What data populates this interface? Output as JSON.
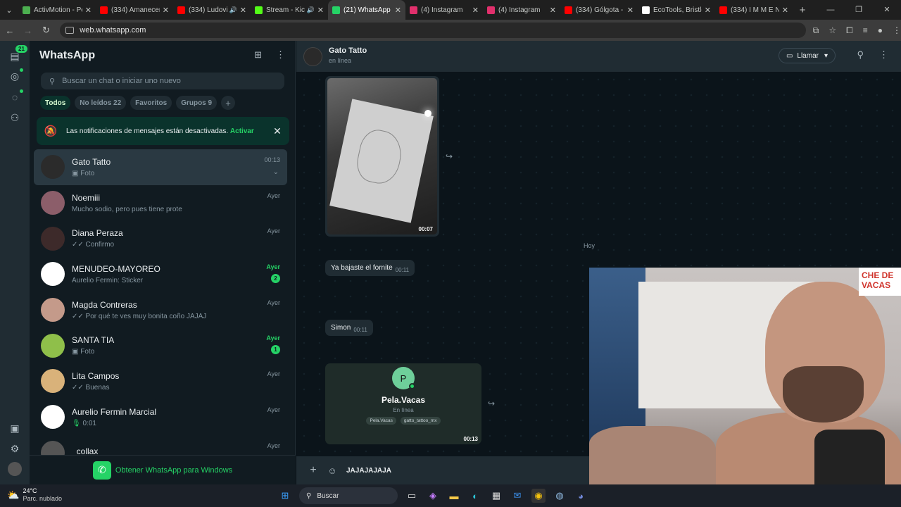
{
  "browser": {
    "tabs": [
      {
        "title": "ActivMotion - Pe...",
        "color": "#4caf50",
        "active": false
      },
      {
        "title": "(334) Amanecere...",
        "color": "#ff0000",
        "active": false
      },
      {
        "title": "(334) Ludovic...",
        "color": "#ff0000",
        "active": false,
        "audio": true
      },
      {
        "title": "Stream - Kick",
        "color": "#53fc18",
        "active": false,
        "audio": true
      },
      {
        "title": "(21) WhatsApp",
        "color": "#25d366",
        "active": true
      },
      {
        "title": "(4) Instagram",
        "color": "#e1306c",
        "active": false
      },
      {
        "title": "(4) Instagram",
        "color": "#e1306c",
        "active": false
      },
      {
        "title": "(334) Gólgota - Y...",
        "color": "#ff0000",
        "active": false
      },
      {
        "title": "EcoTools, Bristle...",
        "color": "#ffffff",
        "active": false
      },
      {
        "title": "(334) I M M E N...",
        "color": "#ff0000",
        "active": false
      }
    ],
    "url": "web.whatsapp.com"
  },
  "rail": {
    "badge": "21"
  },
  "sidebar": {
    "title": "WhatsApp",
    "search_placeholder": "Buscar un chat o iniciar uno nuevo",
    "filters": [
      {
        "label": "Todos",
        "active": true
      },
      {
        "label": "No leídos 22",
        "active": false
      },
      {
        "label": "Favoritos",
        "active": false
      },
      {
        "label": "Grupos 9",
        "active": false
      }
    ],
    "notice": {
      "text": "Las notificaciones de mensajes están desactivadas.",
      "action": "Activar"
    },
    "chats": [
      {
        "name": "Gato Tatto",
        "preview": "Foto",
        "prefix_icon": "photo",
        "time": "00:13",
        "unread": "",
        "selected": true,
        "color": "#2b2b2b"
      },
      {
        "name": "Noemiii",
        "preview": "Mucho sodio, pero pues tiene prote",
        "prefix_icon": "",
        "time": "Ayer",
        "unread": "",
        "color": "#8c5e6a"
      },
      {
        "name": "Diana Peraza",
        "preview": "Confirmo",
        "prefix_icon": "tick",
        "time": "Ayer",
        "unread": "",
        "color": "#3d2a2a"
      },
      {
        "name": "MENUDEO-MAYOREO",
        "preview": "Aurelio Fermin: Sticker",
        "prefix_icon": "",
        "time": "Ayer",
        "unread": "2",
        "color": "#ffffff"
      },
      {
        "name": "Magda Contreras",
        "preview": "Por qué te ves muy bonita coño JAJAJ",
        "prefix_icon": "tick",
        "time": "Ayer",
        "unread": "",
        "color": "#c49a8a"
      },
      {
        "name": "SANTA TIA",
        "preview": "Foto",
        "prefix_icon": "photo",
        "time": "Ayer",
        "unread": "1",
        "color": "#8fbf4a"
      },
      {
        "name": "Lita Campos",
        "preview": "Buenas",
        "prefix_icon": "tick",
        "time": "Ayer",
        "unread": "",
        "color": "#d9b27a"
      },
      {
        "name": "Aurelio Fermin Marcial",
        "preview": "0:01",
        "prefix_icon": "mic",
        "time": "Ayer",
        "unread": "",
        "color": "#ffffff"
      },
      {
        "name": "_collax",
        "preview": "",
        "prefix_icon": "",
        "time": "Ayer",
        "unread": "",
        "color": "#555555"
      }
    ],
    "get_windows": "Obtener WhatsApp para Windows"
  },
  "conversation": {
    "contact_name": "Gato Tatto",
    "status": "en línea",
    "call_label": "Llamar",
    "image_duration": "00:07",
    "day_label": "Hoy",
    "messages": [
      {
        "text": "Ya bajaste el fornite",
        "time": "00:11"
      },
      {
        "text": "Simon",
        "time": "00:11"
      }
    ],
    "card": {
      "initial": "P",
      "name": "Pela.Vacas",
      "status": "En línea",
      "pill1": "Pela.Vacas",
      "pill2": "gatto_tattoo_mx",
      "duration": "00:13"
    },
    "composer_text": "JAJAJAJAJA"
  },
  "overlay": {
    "sign": "CHE DE VACAS"
  },
  "taskbar": {
    "temp": "24°C",
    "weather": "Parc. nublado",
    "search": "Buscar"
  }
}
